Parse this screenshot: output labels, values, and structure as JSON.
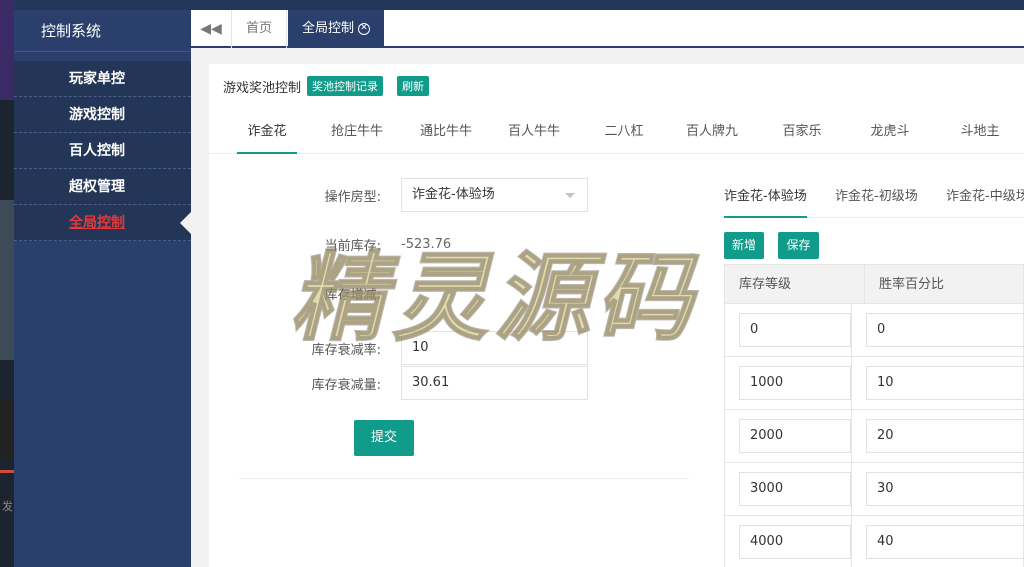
{
  "sidebar": {
    "title": "控制系统",
    "items": [
      {
        "label": "玩家单控"
      },
      {
        "label": "游戏控制"
      },
      {
        "label": "百人控制"
      },
      {
        "label": "超权管理"
      },
      {
        "label": "全局控制"
      }
    ]
  },
  "tabbar": {
    "home": "首页",
    "active": "全局控制"
  },
  "header": {
    "title": "游戏奖池控制",
    "records_btn": "奖池控制记录",
    "refresh_btn": "刷新"
  },
  "game_tabs": [
    "诈金花",
    "抢庄牛牛",
    "通比牛牛",
    "百人牛牛",
    "二八杠",
    "百人牌九",
    "百家乐",
    "龙虎斗",
    "斗地主"
  ],
  "form": {
    "room_label": "操作房型:",
    "room_value": "诈金花-体验场",
    "stock_label": "当前库存:",
    "stock_value": "-523.76",
    "inc_label": "库存增减:",
    "inc_value": "",
    "decay_rate_label": "库存衰减率:",
    "decay_rate_value": "10",
    "decay_amount_label": "库存衰减量:",
    "decay_amount_value": "30.61",
    "submit": "提交"
  },
  "room_tabs": [
    "诈金花-体验场",
    "诈金花-初级场",
    "诈金花-中级场"
  ],
  "table": {
    "add_btn": "新增",
    "save_btn": "保存",
    "headers": [
      "库存等级",
      "胜率百分比"
    ],
    "rows": [
      [
        "0",
        "0"
      ],
      [
        "1000",
        "10"
      ],
      [
        "2000",
        "20"
      ],
      [
        "3000",
        "30"
      ],
      [
        "4000",
        "40"
      ]
    ]
  },
  "watermark": "精灵源码",
  "left_strip_text": "发"
}
